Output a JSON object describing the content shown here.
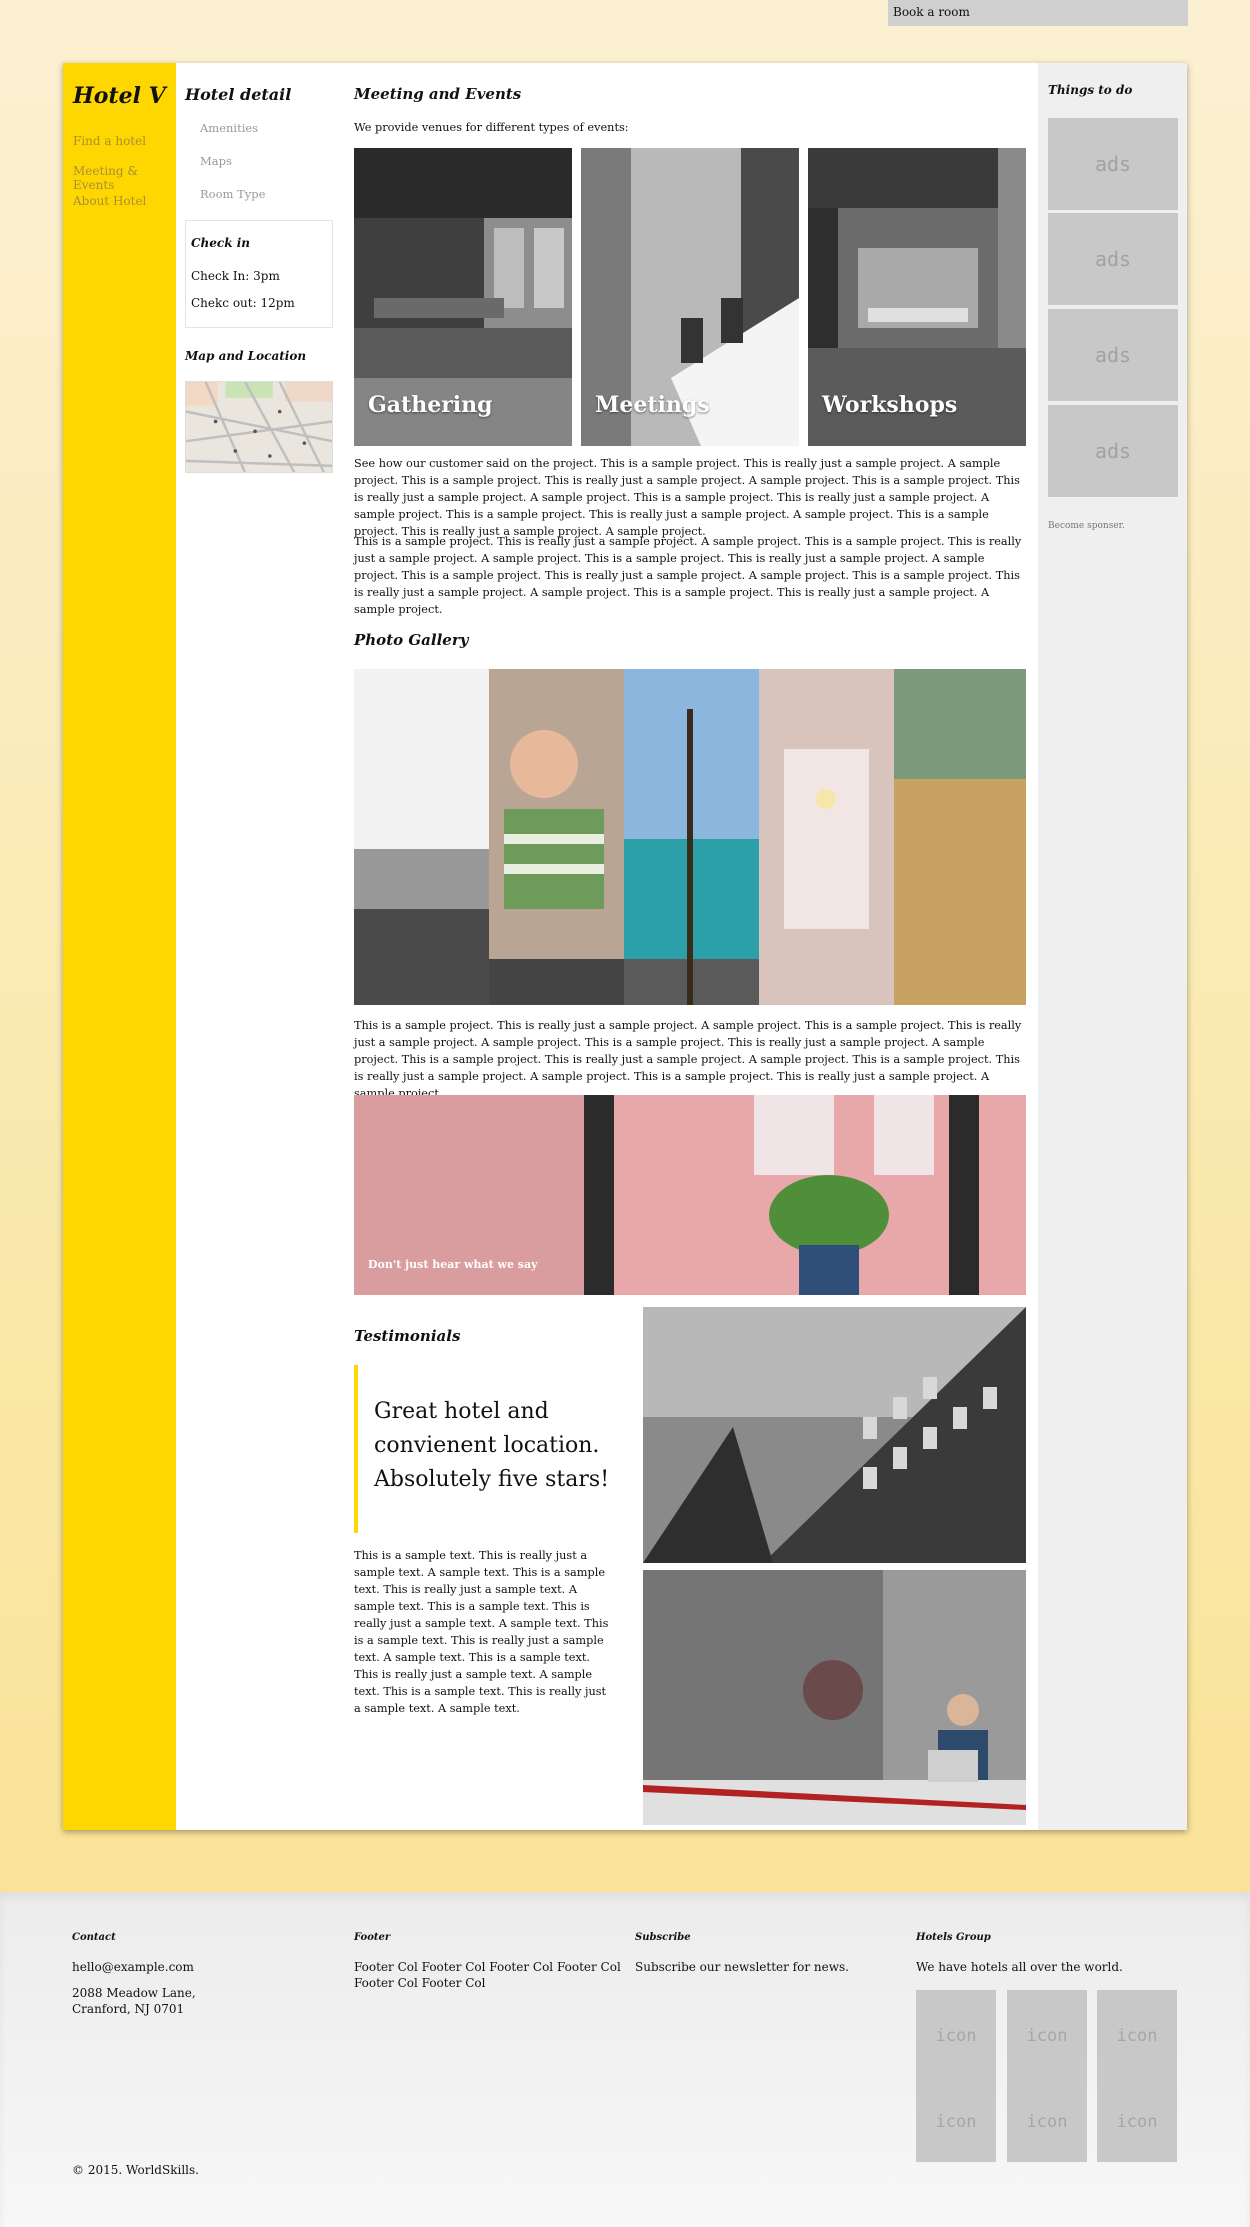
{
  "topbar": {
    "book_room": "Book a room"
  },
  "brand": "Hotel V",
  "leftnav": [
    "Find a hotel",
    "Meeting & Events",
    "About Hotel"
  ],
  "hotel_detail": {
    "title": "Hotel detail",
    "items": [
      "Amenities",
      "Maps",
      "Room Type"
    ],
    "checkin": {
      "title": "Check in",
      "in": "Check In: 3pm",
      "out": "Chekc out: 12pm"
    },
    "map_title": "Map and Location"
  },
  "main": {
    "meeting_title": "Meeting and Events",
    "intro": "We provide venues for different types of events:",
    "tiles": [
      "Gathering",
      "Meetings",
      "Workshops"
    ],
    "para1": "See how our customer said on the project. This is a sample project. This is really just a sample project. A sample project. This is a sample project. This is really just a sample project. A sample project. This is a sample project. This is really just a sample project. A sample project. This is a sample project. This is really just a sample project. A sample project. This is a sample project. This is really just a sample project. A sample project. This is a sample project. This is really just a sample project. A sample project.",
    "para2": "This is a sample project. This is really just a sample project. A sample project. This is a sample project. This is really just a sample project. A sample project. This is a sample project. This is really just a sample project. A sample project. This is a sample project. This is really just a sample project. A sample project. This is a sample project. This is really just a sample project. A sample project. This is a sample project. This is really just a sample project. A sample project.",
    "gallery_title": "Photo Gallery",
    "para3": "This is a sample project. This is really just a sample project. A sample project. This is a sample project. This is really just a sample project. A sample project. This is a sample project. This is really just a sample project. A sample project. This is a sample project. This is really just a sample project. A sample project. This is a sample project. This is really just a sample project. A sample project. This is a sample project. This is really just a sample project. A sample project.",
    "banner_caption": "Don't just hear what we say",
    "testimonials_title": "Testimonials",
    "quote": "Great hotel and convienent location. Absolutely five stars!",
    "para4": "This is a sample text. This is really just a sample text. A sample text. This is a sample text. This is really just a sample text. A sample text. This is a sample text. This is really just a sample text. A sample text. This is a sample text. This is really just a sample text. A sample text. This is a sample text. This is really just a sample text. A sample text. This is a sample text. This is really just a sample text. A sample text."
  },
  "right": {
    "title": "Things to do",
    "ads": [
      "ads",
      "ads",
      "ads",
      "ads"
    ],
    "sponsor": "Become sponser."
  },
  "footer": {
    "contact_title": "Contact",
    "email": "hello@example.com",
    "address1": "2088 Meadow Lane,",
    "address2": "Cranford, NJ 0701",
    "footer_title": "Footer",
    "footer_text": "Footer Col Footer Col Footer Col Footer Col Footer Col Footer Col",
    "subscribe_title": "Subscribe",
    "subscribe_text": "Subscribe our newsletter for news.",
    "group_title": "Hotels Group",
    "group_text": "We have hotels all over the world.",
    "icon_label": "icon",
    "copyright": "© 2015. WorldSkills."
  }
}
